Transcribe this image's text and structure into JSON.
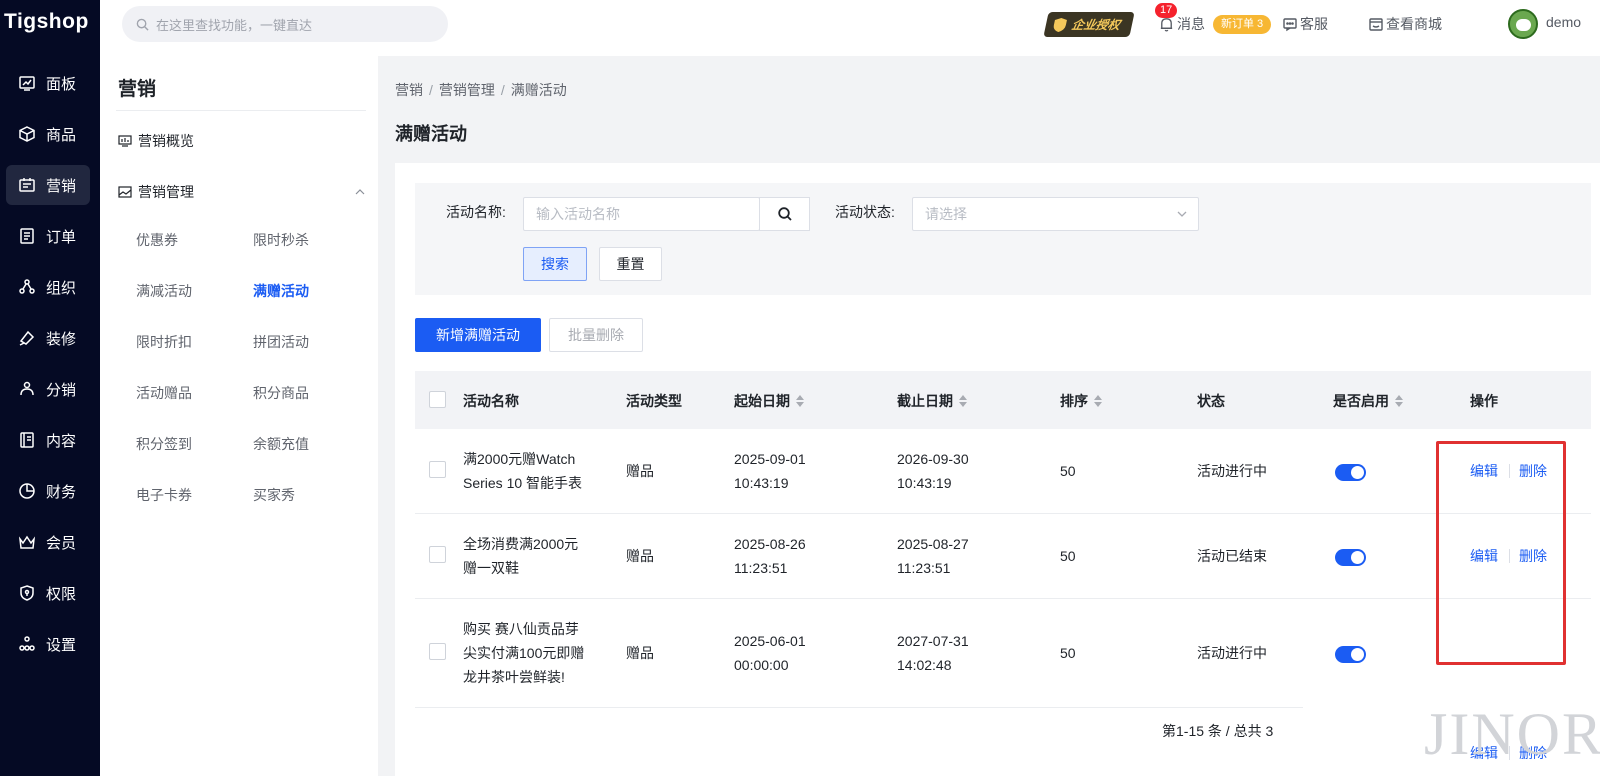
{
  "app": {
    "logo": "Tigshop"
  },
  "left_nav": [
    {
      "label": "面板",
      "icon": "dashboard-icon"
    },
    {
      "label": "商品",
      "icon": "box-icon"
    },
    {
      "label": "营销",
      "icon": "marketing-icon",
      "active": true
    },
    {
      "label": "订单",
      "icon": "order-icon"
    },
    {
      "label": "组织",
      "icon": "org-icon"
    },
    {
      "label": "装修",
      "icon": "brush-icon"
    },
    {
      "label": "分销",
      "icon": "distribution-icon"
    },
    {
      "label": "内容",
      "icon": "content-icon"
    },
    {
      "label": "财务",
      "icon": "finance-icon"
    },
    {
      "label": "会员",
      "icon": "member-icon"
    },
    {
      "label": "权限",
      "icon": "permission-icon"
    },
    {
      "label": "设置",
      "icon": "settings-icon"
    }
  ],
  "topbar": {
    "search_placeholder": "在这里查找功能，一键直达",
    "enterprise_label": "企业授权",
    "message_count": "17",
    "message_label": "消息",
    "new_order_badge": "新订单 3",
    "service_label": "客服",
    "shop_label": "查看商城",
    "user_name": "demo"
  },
  "subnav": {
    "title": "营销",
    "overview": "营销概览",
    "management": "营销管理",
    "items": [
      "优惠券",
      "限时秒杀",
      "满减活动",
      "满赠活动",
      "限时折扣",
      "拼团活动",
      "活动赠品",
      "积分商品",
      "积分签到",
      "余额充值",
      "电子卡券",
      "买家秀"
    ],
    "active_item": "满赠活动"
  },
  "breadcrumb": [
    "营销",
    "营销管理",
    "满赠活动"
  ],
  "page_title": "满赠活动",
  "filter": {
    "name_label": "活动名称:",
    "name_placeholder": "输入活动名称",
    "status_label": "活动状态:",
    "status_placeholder": "请选择",
    "search_btn": "搜索",
    "reset_btn": "重置"
  },
  "actions": {
    "add_btn": "新增满赠活动",
    "batch_delete_btn": "批量删除"
  },
  "table": {
    "headers": {
      "name": "活动名称",
      "type": "活动类型",
      "start": "起始日期",
      "end": "截止日期",
      "sort": "排序",
      "status": "状态",
      "enabled": "是否启用",
      "ops": "操作"
    },
    "rows": [
      {
        "name1": "满2000元赠Watch",
        "name2": "Series 10 智能手表",
        "name3": "",
        "type": "赠品",
        "start1": "2025-09-01",
        "start2": "10:43:19",
        "end1": "2026-09-30",
        "end2": "10:43:19",
        "sort": "50",
        "status": "活动进行中",
        "enabled": true,
        "edit": "编辑",
        "delete": "删除"
      },
      {
        "name1": "全场消费满2000元",
        "name2": "赠一双鞋",
        "name3": "",
        "type": "赠品",
        "start1": "2025-08-26",
        "start2": "11:23:51",
        "end1": "2025-08-27",
        "end2": "11:23:51",
        "sort": "50",
        "status": "活动已结束",
        "enabled": true,
        "edit": "编辑",
        "delete": "删除"
      },
      {
        "name1": "购买 赛八仙贡品芽",
        "name2": "尖实付满100元即赠",
        "name3": "龙井茶叶尝鲜装!",
        "type": "赠品",
        "start1": "2025-06-01",
        "start2": "00:00:00",
        "end1": "2027-07-31",
        "end2": "14:02:48",
        "sort": "50",
        "status": "活动进行中",
        "enabled": true,
        "edit": "编辑",
        "delete": "删除"
      }
    ]
  },
  "pagination": "第1-15 条 / 总共 3",
  "watermark": "JINOR"
}
